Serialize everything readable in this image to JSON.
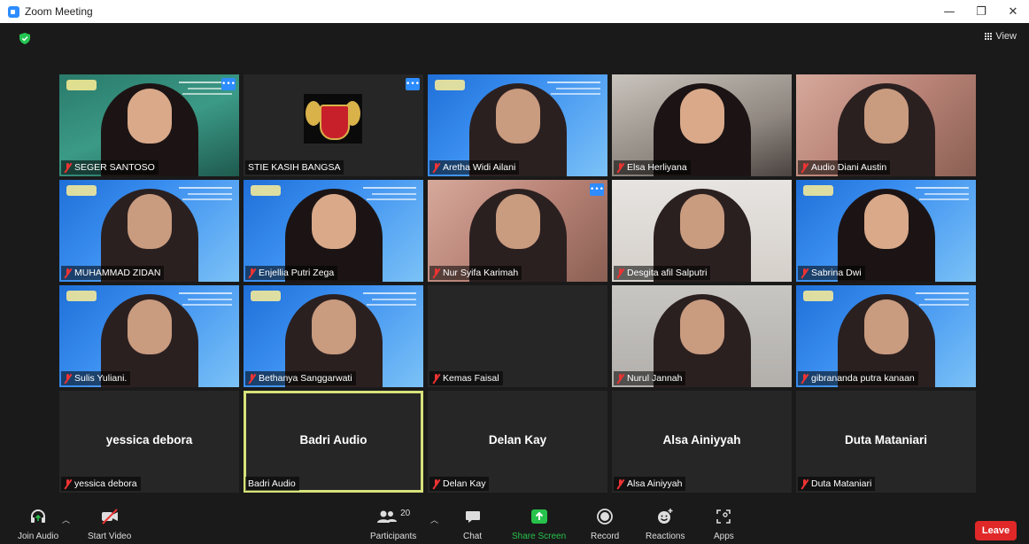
{
  "window": {
    "title": "Zoom Meeting",
    "controls": [
      "—",
      "❐",
      "✕"
    ]
  },
  "header": {
    "view_label": "View"
  },
  "participants": [
    {
      "name": "SEGER SANTOSO",
      "muted": true,
      "scene": "green",
      "more": true
    },
    {
      "name": "STIE KASIH BANGSA",
      "muted": false,
      "scene": "crest",
      "more": true
    },
    {
      "name": "Aretha Widi Ailani",
      "muted": true,
      "scene": "blue"
    },
    {
      "name": "Elsa Herliyana",
      "muted": true,
      "scene": "room"
    },
    {
      "name": "Audio Diani Austin",
      "muted": true,
      "scene": "pink"
    },
    {
      "name": "MUHAMMAD ZIDAN",
      "muted": true,
      "scene": "blue"
    },
    {
      "name": "Enjellia Putri Zega",
      "muted": true,
      "scene": "blue"
    },
    {
      "name": "Nur Syifa Karimah",
      "muted": true,
      "scene": "pink",
      "more": true
    },
    {
      "name": "Desgita afil Salputri",
      "muted": true,
      "scene": "wall"
    },
    {
      "name": "Sabrina Dwi",
      "muted": true,
      "scene": "blue"
    },
    {
      "name": "Sulis Yuliani.",
      "muted": true,
      "scene": "blue"
    },
    {
      "name": "Bethanya Sanggarwati",
      "muted": true,
      "scene": "blue"
    },
    {
      "name": "Kemas Faisal",
      "muted": true,
      "scene": "off"
    },
    {
      "name": "Nurul Jannah",
      "muted": true,
      "scene": "gray"
    },
    {
      "name": "gibrananda putra kanaan",
      "muted": true,
      "scene": "blue"
    },
    {
      "name": "yessica debora",
      "muted": true,
      "scene": "name",
      "display": "yessica debora"
    },
    {
      "name": "Badri Audio",
      "muted": false,
      "scene": "name",
      "display": "Badri Audio",
      "active": true
    },
    {
      "name": "Delan Kay",
      "muted": true,
      "scene": "name",
      "display": "Delan Kay"
    },
    {
      "name": "Alsa Ainiyyah",
      "muted": true,
      "scene": "name",
      "display": "Alsa Ainiyyah"
    },
    {
      "name": "Duta Mataniari",
      "muted": true,
      "scene": "name",
      "display": "Duta Mataniari"
    }
  ],
  "toolbar": {
    "join_audio": "Join Audio",
    "start_video": "Start Video",
    "participants": "Participants",
    "participants_count": "20",
    "chat": "Chat",
    "share_screen": "Share Screen",
    "record": "Record",
    "reactions": "Reactions",
    "apps": "Apps",
    "leave": "Leave"
  },
  "colors": {
    "accent": "#2d8cff",
    "share_green": "#27c24c",
    "leave_red": "#e02828",
    "active_border": "#d7e27a"
  }
}
